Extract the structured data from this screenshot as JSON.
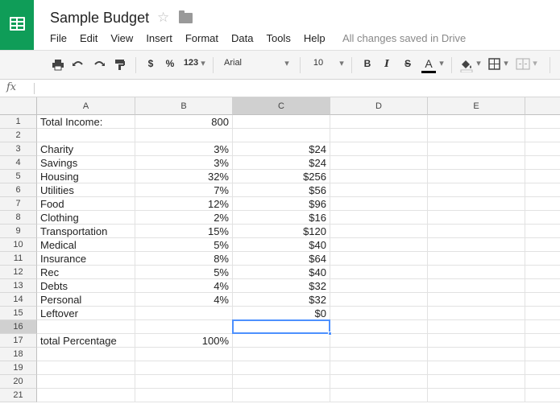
{
  "app": {
    "title": "Sample Budget",
    "save_status": "All changes saved in Drive",
    "menu": [
      "File",
      "Edit",
      "View",
      "Insert",
      "Format",
      "Data",
      "Tools",
      "Help"
    ]
  },
  "toolbar": {
    "currency_label": "$",
    "percent_label": "%",
    "number_format_label": "123",
    "font": "Arial",
    "font_size": "10",
    "bold_label": "B",
    "italic_label": "I",
    "strike_label": "S",
    "text_color_label": "A"
  },
  "formula_bar": {
    "fx_label": "fx",
    "value": ""
  },
  "sheet": {
    "columns": [
      "A",
      "B",
      "C",
      "D",
      "E"
    ],
    "selected_column": "C",
    "selected_row": 16,
    "rows": [
      {
        "n": "1",
        "a": "Total Income:",
        "b": "800",
        "c": ""
      },
      {
        "n": "2",
        "a": "",
        "b": "",
        "c": ""
      },
      {
        "n": "3",
        "a": "Charity",
        "b": "3%",
        "c": "$24"
      },
      {
        "n": "4",
        "a": "Savings",
        "b": "3%",
        "c": "$24"
      },
      {
        "n": "5",
        "a": "Housing",
        "b": "32%",
        "c": "$256"
      },
      {
        "n": "6",
        "a": "Utilities",
        "b": "7%",
        "c": "$56"
      },
      {
        "n": "7",
        "a": "Food",
        "b": "12%",
        "c": "$96"
      },
      {
        "n": "8",
        "a": "Clothing",
        "b": "2%",
        "c": "$16"
      },
      {
        "n": "9",
        "a": "Transportation",
        "b": "15%",
        "c": "$120"
      },
      {
        "n": "10",
        "a": "Medical",
        "b": "5%",
        "c": "$40"
      },
      {
        "n": "11",
        "a": "Insurance",
        "b": "8%",
        "c": "$64"
      },
      {
        "n": "12",
        "a": "Rec",
        "b": "5%",
        "c": "$40"
      },
      {
        "n": "13",
        "a": "Debts",
        "b": "4%",
        "c": "$32"
      },
      {
        "n": "14",
        "a": "Personal",
        "b": "4%",
        "c": "$32"
      },
      {
        "n": "15",
        "a": "Leftover",
        "b": "",
        "c": "$0"
      },
      {
        "n": "16",
        "a": "",
        "b": "",
        "c": ""
      },
      {
        "n": "17",
        "a": "total Percentage",
        "b": "100%",
        "c": ""
      },
      {
        "n": "18",
        "a": "",
        "b": "",
        "c": ""
      },
      {
        "n": "19",
        "a": "",
        "b": "",
        "c": ""
      },
      {
        "n": "20",
        "a": "",
        "b": "",
        "c": ""
      },
      {
        "n": "21",
        "a": "",
        "b": "",
        "c": ""
      }
    ]
  },
  "colors": {
    "brand": "#0f9d58",
    "selection": "#4d90fe"
  }
}
